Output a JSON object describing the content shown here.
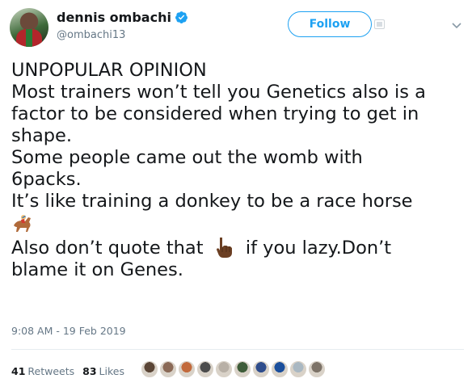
{
  "user": {
    "display_name": "dennis ombachi",
    "handle": "@ombachi13",
    "verified_icon": "verified-badge-icon"
  },
  "actions": {
    "follow_label": "Follow"
  },
  "tweet": {
    "lines": [
      "UNPOPULAR OPINION",
      "Most trainers won’t tell you Genetics also is a",
      "factor to be considered when trying to get in",
      "shape.",
      "Some people came out the womb with",
      "6packs.",
      "It’s like training a donkey to be a race horse"
    ],
    "emoji_horse": "horse-racing-emoji",
    "line_quote_before": "Also don’t quote that",
    "emoji_hand": "pointing-hand-emoji",
    "line_quote_after": "if you lazy.Don’t",
    "last_line": "blame it on Genes."
  },
  "meta": {
    "timestamp": "9:08 AM - 19 Feb 2019"
  },
  "stats": {
    "retweets_count": "41",
    "retweets_label": "Retweets",
    "likes_count": "83",
    "likes_label": "Likes"
  },
  "likers": [
    {
      "color": "#5a4536"
    },
    {
      "color": "#8b6a57"
    },
    {
      "color": "#c26a3c"
    },
    {
      "color": "#4c4c4c"
    },
    {
      "color": "#b8b0a6"
    },
    {
      "color": "#3f5d3a"
    },
    {
      "color": "#2f4d8c"
    },
    {
      "color": "#1b4f9c"
    },
    {
      "color": "#aab8c2"
    },
    {
      "color": "#7d7368"
    }
  ],
  "colors": {
    "accent": "#1da1f2",
    "text": "#14171a",
    "muted": "#657786"
  }
}
